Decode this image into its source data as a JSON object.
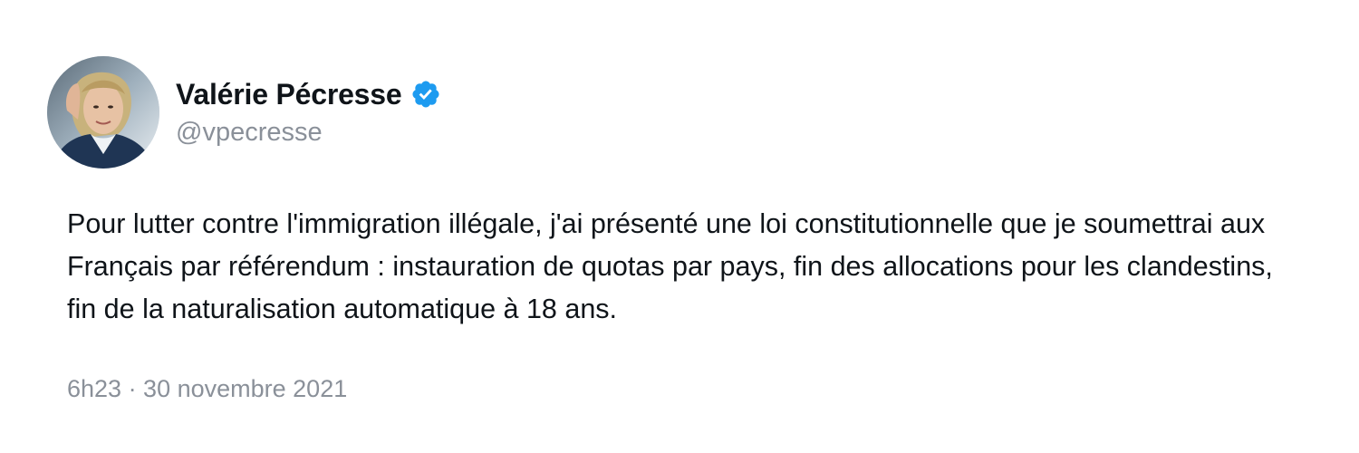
{
  "author": {
    "display_name": "Valérie Pécresse",
    "handle": "@vpecresse",
    "verified_icon": "verified-badge-icon",
    "badge_color": "#1d9bf0"
  },
  "tweet": {
    "text": "Pour lutter contre l'immigration illégale, j'ai présenté une loi constitutionnelle que je soumettrai aux Français par référendum : instauration de quotas par pays, fin des allocations pour les clandestins, fin de la naturalisation automatique à 18 ans.",
    "timestamp": "6h23 · 30 novembre 2021"
  },
  "colors": {
    "text_primary": "#0f1419",
    "text_secondary": "#8a9099",
    "background": "#ffffff"
  }
}
